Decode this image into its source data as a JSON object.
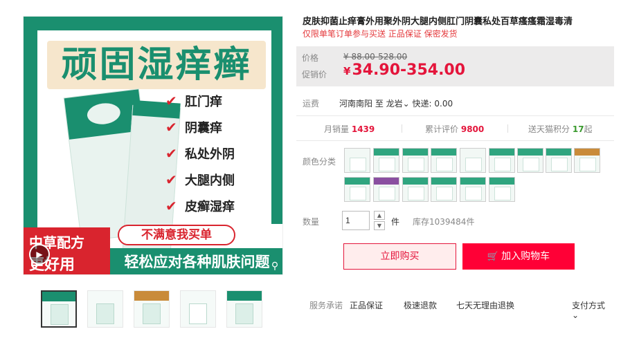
{
  "product": {
    "title": "皮肤抑菌止痒膏外用聚外阴大腿内侧肛门阴囊私处百草瘙瘙霜湿毒清",
    "subtitle": "仅限单笔订单参与买送 正品保证 保密发货"
  },
  "gallery": {
    "hero_title": "顽固湿痒癣",
    "features": [
      "肛门痒",
      "阴囊痒",
      "私处外阴",
      "大腿内侧",
      "皮癣湿痒"
    ],
    "badge_line1": "中草配方",
    "badge_line2": "更好用",
    "pill_text": "不满意我买单",
    "bottom_slogan": "轻松应对各种肌肤问题",
    "thumb_count": 5
  },
  "price": {
    "label_original": "价格",
    "original": "¥ 88.00-528.00",
    "label_promo": "促销价",
    "currency": "¥",
    "promo": "34.90-354.00"
  },
  "shipping": {
    "label": "运费",
    "text": "河南南阳 至 龙岩",
    "chevron": "⌄",
    "express": "快递: 0.00"
  },
  "stats": {
    "monthly_label": "月销量",
    "monthly_value": "1439",
    "reviews_label": "累计评价",
    "reviews_value": "9800",
    "points_label": "送天猫积分",
    "points_value": "17",
    "points_suffix": "起"
  },
  "sku": {
    "label": "颜色分类",
    "swatch_count": 15
  },
  "quantity": {
    "label": "数量",
    "value": "1",
    "unit": "件",
    "stock": "库存1039484件",
    "up": "▲",
    "down": "▼"
  },
  "actions": {
    "buy_now": "立即购买",
    "add_to_cart": "加入购物车"
  },
  "service": {
    "label": "服务承诺",
    "items": [
      "正品保证",
      "极速退款",
      "七天无理由退换"
    ],
    "payment": "支付方式",
    "payment_chevron": "⌄"
  },
  "icons": {
    "check": "check-icon",
    "play": "play-icon",
    "zoom": "zoom-icon",
    "cart": "cart-icon"
  },
  "colors": {
    "brand_green": "#1a8f6f",
    "price_red": "#e4153b",
    "cart_red": "#ff0036",
    "accent_red": "#d9242e"
  }
}
